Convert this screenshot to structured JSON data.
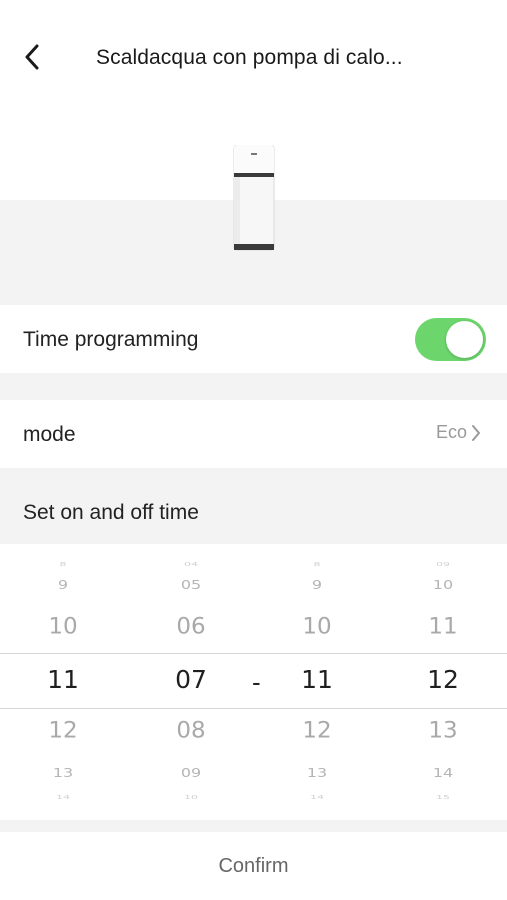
{
  "header": {
    "title": "Scaldacqua con pompa di calo...",
    "back_icon": "chevron-left-icon"
  },
  "device": {
    "image": "water-heater-image"
  },
  "time_programming": {
    "label": "Time programming",
    "enabled": true,
    "toggle_color": "#6cd66c"
  },
  "mode": {
    "label": "mode",
    "value": "Eco",
    "chevron_icon": "chevron-right-icon"
  },
  "schedule": {
    "section_title": "Set on and off time"
  },
  "picker": {
    "separator": "-",
    "columns": [
      {
        "name": "start-hour",
        "items": [
          "8",
          "9",
          "10",
          "11",
          "12",
          "13",
          "14"
        ],
        "selected": "11"
      },
      {
        "name": "start-minute",
        "items": [
          "04",
          "05",
          "06",
          "07",
          "08",
          "09",
          "10"
        ],
        "selected": "07"
      },
      {
        "name": "end-hour",
        "items": [
          "8",
          "9",
          "10",
          "11",
          "12",
          "13",
          "14"
        ],
        "selected": "11"
      },
      {
        "name": "end-minute",
        "items": [
          "09",
          "10",
          "11",
          "12",
          "13",
          "14",
          "15"
        ],
        "selected": "12"
      }
    ]
  },
  "footer": {
    "confirm_label": "Confirm"
  }
}
